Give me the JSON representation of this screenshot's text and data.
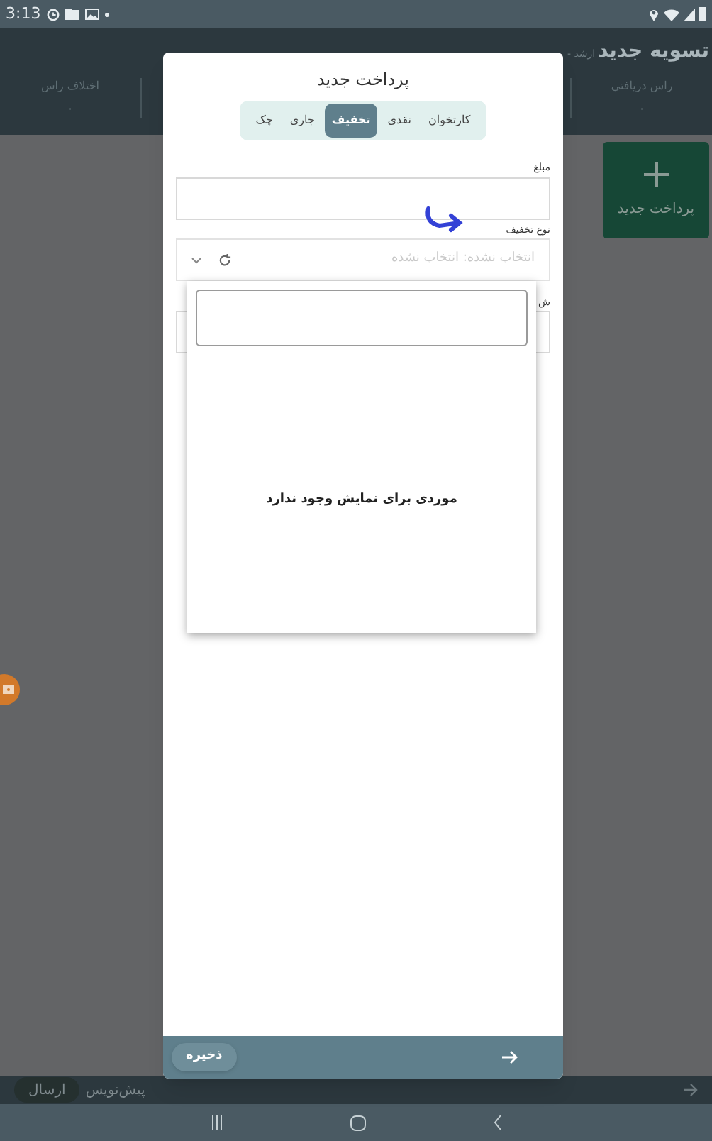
{
  "status_bar": {
    "time": "3:13"
  },
  "header": {
    "title": "تسویه جدید",
    "subtitle": "ارشد -",
    "stats": [
      {
        "label": "راس دریافتی",
        "value": "۰"
      },
      {
        "label": "اختلاف راس",
        "value": "۰"
      }
    ]
  },
  "new_payment_card": {
    "label": "پرداخت جدید"
  },
  "bottom_bar": {
    "draft": "پیش‌نویس",
    "send": "ارسال"
  },
  "dialog": {
    "title": "پرداخت جدید",
    "tabs": [
      {
        "label": "کارتخوان",
        "selected": false
      },
      {
        "label": "نقدی",
        "selected": false
      },
      {
        "label": "تخفیف",
        "selected": true
      },
      {
        "label": "جاری",
        "selected": false
      },
      {
        "label": "چک",
        "selected": false
      }
    ],
    "amount": {
      "label": "مبلغ"
    },
    "discount_type": {
      "label": "نوع تخفیف",
      "placeholder": "انتخاب نشده: انتخاب نشده"
    },
    "hidden_field": {
      "label": "ش"
    },
    "dropdown": {
      "empty_message": "موردی برای نمایش وجود ندارد"
    },
    "save": "ذخیره"
  }
}
